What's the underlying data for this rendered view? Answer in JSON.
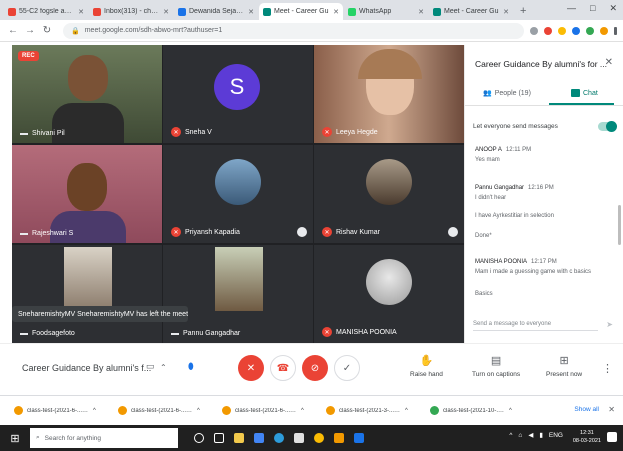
{
  "browser": {
    "tabs": [
      {
        "label": "55-C2 fogsle and yo",
        "icon": "gmail-icon",
        "color": "#ea4335",
        "active": false
      },
      {
        "label": "Inbox(313) - charlie.cr",
        "icon": "gmail-icon",
        "color": "#ea4335",
        "active": false
      },
      {
        "label": "Dewanida Sejari Ru",
        "icon": "classroom-icon",
        "color": "#1a73e8",
        "active": false
      },
      {
        "label": "Meet - Career Gu",
        "icon": "meet-icon",
        "color": "#00897b",
        "active": true
      },
      {
        "label": "WhatsApp",
        "icon": "whatsapp-icon",
        "color": "#25d366",
        "active": false
      },
      {
        "label": "Meet - Career Gu",
        "icon": "meet-icon",
        "color": "#00897b",
        "active": false
      }
    ],
    "new_tab": "+",
    "window_controls": [
      "—",
      "□",
      "✕"
    ],
    "url": "meet.google.com/sdh-abwo-mrt?authuser=1"
  },
  "meeting": {
    "recording_badge": "REC",
    "participants": [
      {
        "name": "Shivani Pil",
        "muted": false
      },
      {
        "name": "Sneha V",
        "initial": "S",
        "muted": true
      },
      {
        "name": "Leeya Hegde",
        "muted": true
      },
      {
        "name": "Rajeshwari S",
        "muted": false
      },
      {
        "name": "Priyansh Kapadia",
        "muted": true
      },
      {
        "name": "Rishav Kumar",
        "muted": true
      },
      {
        "name": "Pannu Gangadhar",
        "muted": false
      },
      {
        "name": "MANISHA POONIA",
        "muted": true
      },
      {
        "name": "Foodsagefoto",
        "muted": false
      }
    ],
    "toast": "SneharemishtyMV SneharemishtyMV has left the meeting",
    "name": "Career Guidance By alumni's f..."
  },
  "panel": {
    "title": "Career Guidance By alumni's for ...",
    "tabs": {
      "people": "People (19)",
      "chat": "Chat"
    },
    "allow_messages": "Let everyone send messages",
    "messages": [
      {
        "sender": "ANOOP A",
        "time": "12:11 PM",
        "text": "Yes mam"
      },
      {
        "sender": "Pannu Gangadhar",
        "time": "12:16 PM",
        "text": "I didn't hear"
      },
      {
        "sender": "",
        "time": "",
        "text": "I have Ayrkestitiar in selection"
      },
      {
        "sender": "",
        "time": "",
        "text": "Done*"
      },
      {
        "sender": "MANISHA POONIA",
        "time": "12:17 PM",
        "text": "Mam i made a guessing game with c basics"
      },
      {
        "sender": "",
        "time": "",
        "text": "Basics"
      }
    ],
    "input_placeholder": "Send a message to everyone"
  },
  "controls": {
    "raise_hand": "Raise hand",
    "captions": "Turn on captions",
    "present": "Present now"
  },
  "downloads": {
    "items": [
      "class-test-(2021-6-....html",
      "class-test-(2021-6-....html",
      "class-test-(2021-6-....html",
      "class-test-(2021-3-...html",
      "class-test-(2021-10-...aspx"
    ],
    "show_all": "Show all"
  },
  "taskbar": {
    "search_placeholder": "Search for anything",
    "tray_lang": "ENG",
    "time": "12:31",
    "date": "08-03-2021"
  }
}
